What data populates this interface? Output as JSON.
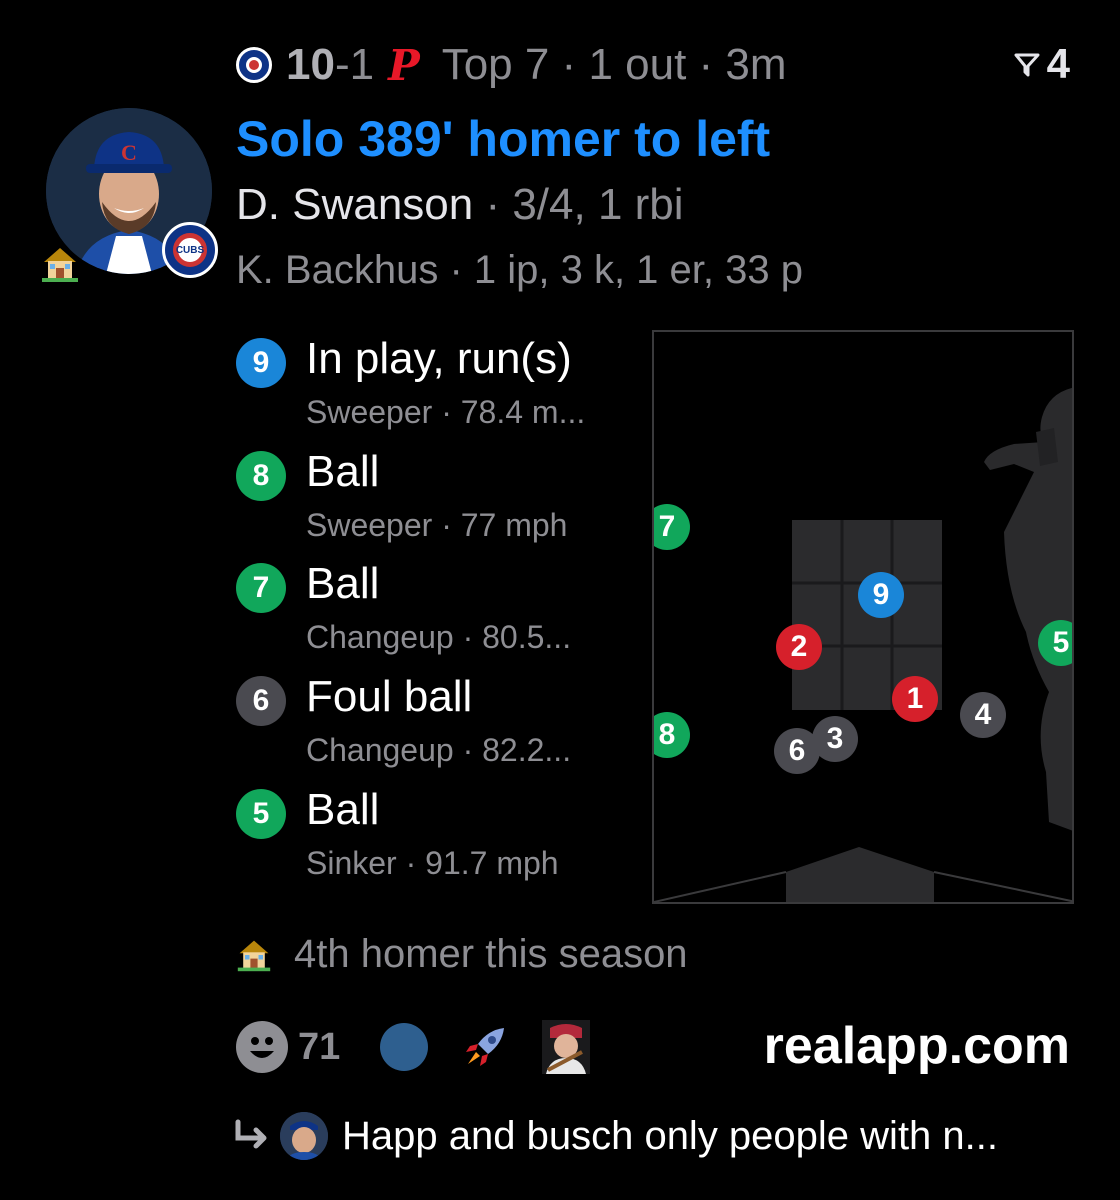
{
  "header": {
    "score_home": "10",
    "score_sep": "-",
    "score_away": "1",
    "away_logo_letter": "P",
    "inning": "Top 7",
    "outs": "1 out",
    "time_ago": "3m",
    "filter_count": "4"
  },
  "play": {
    "headline": "Solo 389' homer to left",
    "batter_name": "D. Swanson",
    "batter_stats": " · 3/4, 1 rbi",
    "pitcher_line": "K. Backhus · 1 ip, 3 k, 1 er, 33 p",
    "team_badge": "CUBS"
  },
  "pitches": [
    {
      "num": "9",
      "result": "In play, run(s)",
      "detail": "Sweeper · 78.4 m...",
      "color": "#1a86d8"
    },
    {
      "num": "8",
      "result": "Ball",
      "detail": "Sweeper · 77 mph",
      "color": "#11a75b"
    },
    {
      "num": "7",
      "result": "Ball",
      "detail": "Changeup · 80.5...",
      "color": "#11a75b"
    },
    {
      "num": "6",
      "result": "Foul ball",
      "detail": "Changeup · 82.2...",
      "color": "#4a4a50"
    },
    {
      "num": "5",
      "result": "Ball",
      "detail": "Sinker · 91.7 mph",
      "color": "#11a75b"
    }
  ],
  "zone_dots": [
    {
      "num": "7",
      "color": "#11a75b"
    },
    {
      "num": "9",
      "color": "#1a86d8"
    },
    {
      "num": "2",
      "color": "#d6202b"
    },
    {
      "num": "5",
      "color": "#11a75b"
    },
    {
      "num": "1",
      "color": "#d6202b"
    },
    {
      "num": "4",
      "color": "#4a4a50"
    },
    {
      "num": "8",
      "color": "#11a75b"
    },
    {
      "num": "3",
      "color": "#4a4a50"
    },
    {
      "num": "6",
      "color": "#4a4a50"
    }
  ],
  "note": "4th homer this season",
  "reactions": {
    "count": "71"
  },
  "brand": "realapp.com",
  "reply": {
    "text": "Happ and busch only people with n..."
  }
}
